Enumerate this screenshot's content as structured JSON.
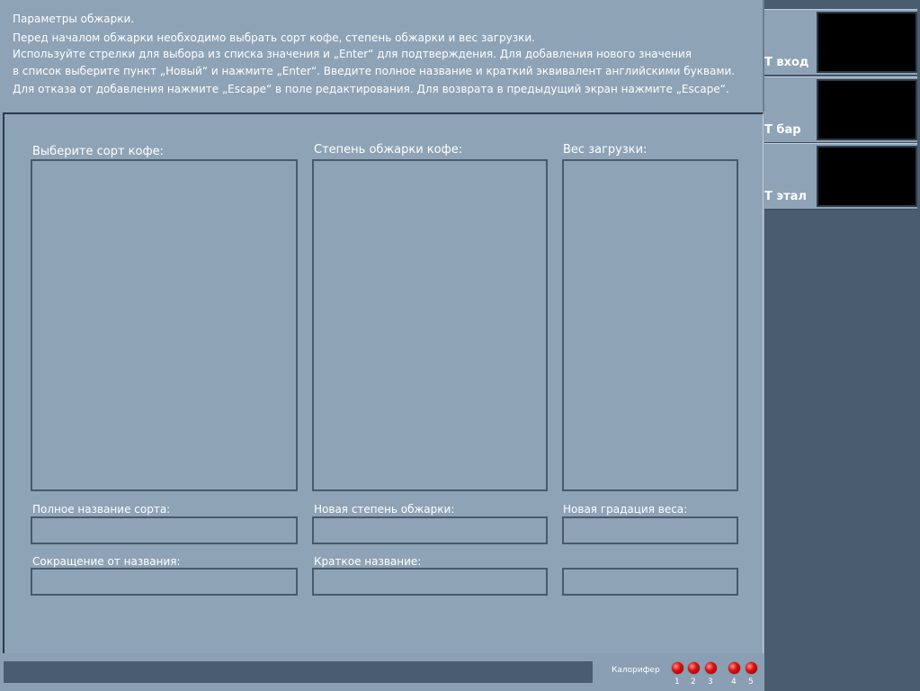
{
  "instructions": {
    "title": "Параметры обжарки.",
    "lines": [
      "Перед началом обжарки необходимо выбрать сорт кофе, степень обжарки и вес загрузки.",
      "Используйте стрелки для выбора из списка значения и „Enter“ для подтверждения. Для добавления нового значения",
      "в список выберите пункт „Новый“ и нажмите „Enter“. Введите полное название и краткий эквивалент английскими буквами.",
      "Для отказа от добавления нажмите „Escape“ в поле редактирования. Для возврата в предыдущий экран нажмите „Escape“."
    ]
  },
  "columns": {
    "sort": {
      "heading": "Выберите сорт кофе:",
      "field1_label": "Полное название сорта:",
      "field1_value": "",
      "field2_label": "Сокращение от названия:",
      "field2_value": "",
      "items": []
    },
    "roast": {
      "heading": "Степень обжарки кофе:",
      "field1_label": "Новая степень обжарки:",
      "field1_value": "",
      "field2_label": "Краткое название:",
      "field2_value": "",
      "items": []
    },
    "weight": {
      "heading": "Вес загрузки:",
      "field1_label": "Новая градация веса:",
      "field1_value": "",
      "field2_label": "",
      "field2_value": "",
      "items": []
    }
  },
  "status": {
    "message": "",
    "heater_label": "Калорифер",
    "heater_leds": [
      "1",
      "2",
      "3",
      "4",
      "5"
    ],
    "led_color": "#e01010"
  },
  "gauges": [
    {
      "label": "Т вход",
      "value": ""
    },
    {
      "label": "Т бар",
      "value": ""
    },
    {
      "label": "Т этал",
      "value": ""
    }
  ],
  "colors": {
    "panel": "#8ea3b6",
    "side": "#4a5d70",
    "border": "#485a6b",
    "text": "#ffffff"
  }
}
